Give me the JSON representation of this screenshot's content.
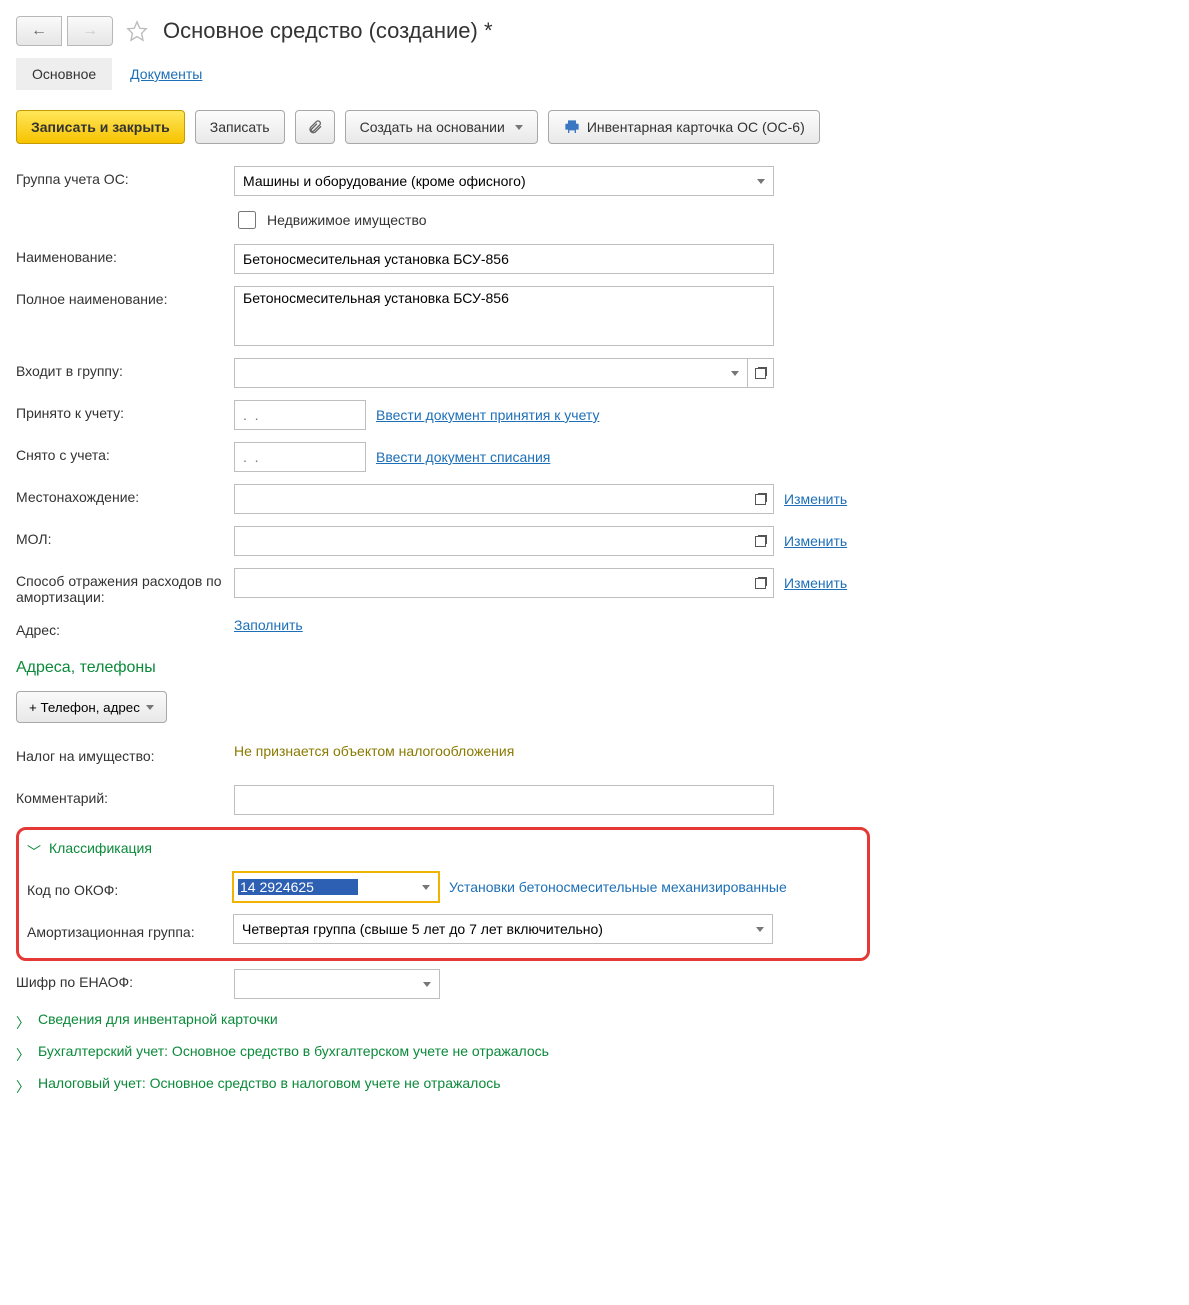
{
  "header": {
    "title": "Основное средство (создание) *"
  },
  "tabs": {
    "main": "Основное",
    "documents": "Документы"
  },
  "toolbar": {
    "save_close": "Записать и закрыть",
    "save": "Записать",
    "create_based_on": "Создать на основании",
    "inventory_card": "Инвентарная карточка ОС (ОС-6)"
  },
  "labels": {
    "accounting_group": "Группа учета ОС:",
    "real_estate": "Недвижимое имущество",
    "name": "Наименование:",
    "full_name": "Полное наименование:",
    "in_group": "Входит в группу:",
    "accepted": "Принято к учету:",
    "accepted_link": "Ввести документ принятия к учету",
    "removed": "Снято с учета:",
    "removed_link": "Ввести документ списания",
    "location": "Местонахождение:",
    "mol": "МОЛ:",
    "expense_method": "Способ отражения расходов по амортизации:",
    "address": "Адрес:",
    "fill": "Заполнить",
    "addresses_phones": "Адреса, телефоны",
    "add_phone": "+ Телефон, адрес",
    "property_tax": "Налог на имущество:",
    "property_tax_value": "Не признается объектом налогообложения",
    "comment": "Комментарий:",
    "change": "Изменить",
    "classification": "Классификация",
    "okof": "Код по ОКОФ:",
    "okof_descr": "Установки бетоносмесительные механизированные",
    "amort_group": "Амортизационная группа:",
    "enaof": "Шифр по ЕНАОФ:",
    "collapse_inventory": "Сведения для инвентарной карточки",
    "collapse_bu": "Бухгалтерский учет: Основное средство в бухгалтерском учете не отражалось",
    "collapse_nu": "Налоговый учет: Основное средство в налоговом учете не отражалось"
  },
  "values": {
    "accounting_group": "Машины и оборудование (кроме офисного)",
    "name": "Бетоносмесительная установка БСУ-856",
    "full_name": "Бетоносмесительная установка БСУ-856",
    "date_placeholder": ".  .",
    "okof_value": "14 2924625",
    "amort_group": "Четвертая группа (свыше 5 лет до 7 лет включительно)"
  }
}
